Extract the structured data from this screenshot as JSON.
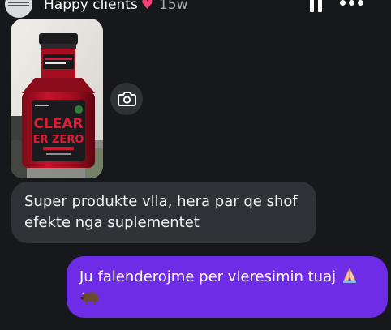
{
  "header": {
    "title": "Happy clients",
    "title_emoji_icon": "pink-heart-icon",
    "time": "15w",
    "controls": [
      "pause-icon",
      "more-options-icon"
    ]
  },
  "photo": {
    "product_label_line1": "CLEAR",
    "product_label_line2": "ER ZERO",
    "camera_icon": "camera-icon"
  },
  "messages": [
    {
      "direction": "incoming",
      "text": "Super produkte vlla, hera par qe shof\nefekte nga suplementet"
    },
    {
      "direction": "outgoing",
      "text": "Ju falenderojme per vleresimin tuaj",
      "trailing_icons": [
        "folded-hands-emoji-icon",
        "bison-emoji-icon"
      ]
    }
  ],
  "colors": {
    "background": "#17181c",
    "incoming_bubble": "#303238",
    "outgoing_bubble": "#6f2ce6",
    "heart": "#f0457a"
  }
}
